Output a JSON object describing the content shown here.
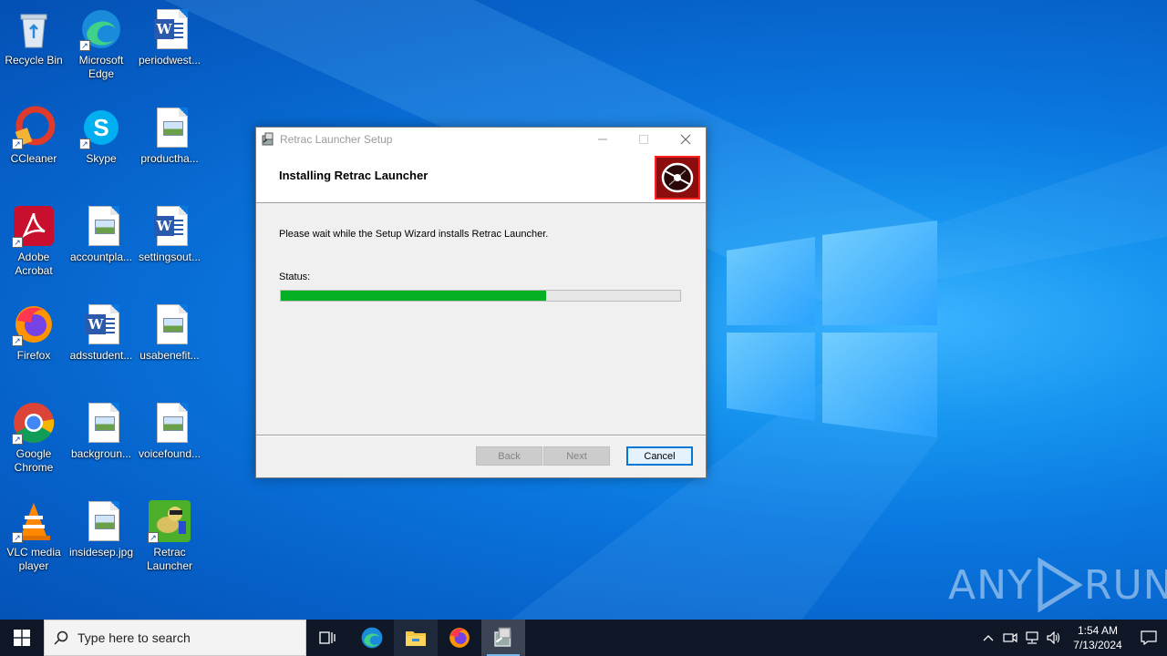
{
  "desktop": {
    "icons": [
      {
        "label": "Recycle Bin"
      },
      {
        "label": "Microsoft Edge"
      },
      {
        "label": "periodwest..."
      },
      {
        "label": "CCleaner"
      },
      {
        "label": "Skype"
      },
      {
        "label": "productha..."
      },
      {
        "label": "Adobe Acrobat"
      },
      {
        "label": "accountpla..."
      },
      {
        "label": "settingsout..."
      },
      {
        "label": "Firefox"
      },
      {
        "label": "adsstudent..."
      },
      {
        "label": "usabenefit..."
      },
      {
        "label": "Google Chrome"
      },
      {
        "label": "backgroun..."
      },
      {
        "label": "voicefound..."
      },
      {
        "label": "VLC media player"
      },
      {
        "label": "insidesep.jpg"
      },
      {
        "label": "Retrac Launcher"
      }
    ]
  },
  "dialog": {
    "title": "Retrac Launcher Setup",
    "heading": "Installing Retrac Launcher",
    "description": "Please wait while the Setup Wizard installs Retrac Launcher.",
    "status_label": "Status:",
    "progress_fraction": 0.665,
    "buttons": {
      "back": "Back",
      "next": "Next",
      "cancel": "Cancel"
    }
  },
  "watermark": {
    "text_left": "ANY",
    "text_right": "RUN"
  },
  "taskbar": {
    "search_placeholder": "Type here to search",
    "time": "1:54 AM",
    "date": "7/13/2024"
  },
  "colors": {
    "progress_fill": "#06b025",
    "taskbar_bg": "#101828",
    "accent": "#0078d7"
  }
}
